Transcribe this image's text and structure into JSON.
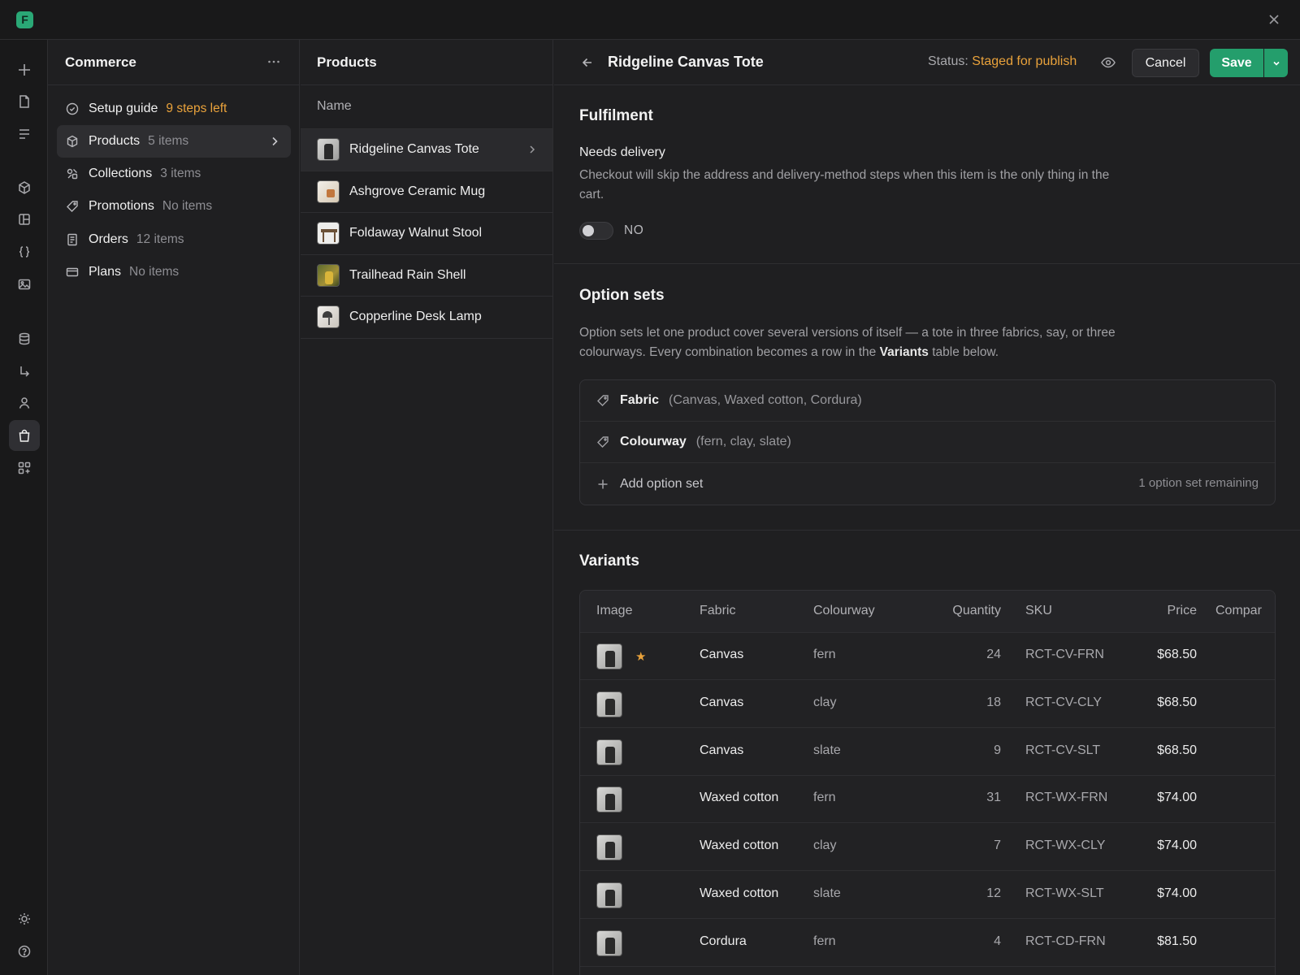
{
  "app": {
    "logo_letter": "F"
  },
  "rail": {
    "icons": [
      "plus-icon",
      "document-icon",
      "text-lines-icon",
      "cube-icon",
      "layout-icon",
      "code-braces-icon",
      "image-icon",
      "database-icon",
      "arrow-turn-icon",
      "user-icon",
      "shopping-bag-icon",
      "apps-add-icon",
      "sun-icon",
      "help-icon"
    ],
    "active": "shopping-bag-icon"
  },
  "sidebar": {
    "title": "Commerce",
    "items": [
      {
        "label": "Setup guide",
        "count": "9 steps left",
        "icon": "check-circle-icon",
        "warn": true
      },
      {
        "label": "Products",
        "count": "5 items",
        "icon": "cube-icon",
        "active": true
      },
      {
        "label": "Collections",
        "count": "3 items",
        "icon": "collections-icon"
      },
      {
        "label": "Promotions",
        "count": "No items",
        "icon": "tag-icon"
      },
      {
        "label": "Orders",
        "count": "12 items",
        "icon": "receipt-icon"
      },
      {
        "label": "Plans",
        "count": "No items",
        "icon": "card-icon"
      }
    ]
  },
  "products": {
    "title": "Products",
    "column": "Name",
    "items": [
      {
        "label": "Ridgeline Canvas Tote",
        "active": true
      },
      {
        "label": "Ashgrove Ceramic Mug"
      },
      {
        "label": "Foldaway Walnut Stool"
      },
      {
        "label": "Trailhead Rain Shell"
      },
      {
        "label": "Copperline Desk Lamp"
      }
    ]
  },
  "detail": {
    "title": "Ridgeline Canvas Tote",
    "status_label": "Status:",
    "status_value": "Staged for publish",
    "cancel_label": "Cancel",
    "save_label": "Save",
    "accent": "#249e6c",
    "warn_color": "#e9a23b"
  },
  "fulfilment": {
    "title": "Fulfilment",
    "field_label": "Needs delivery",
    "description": "Checkout will skip the address and delivery-method steps when this item is the only thing in the cart.",
    "toggle_value": "NO"
  },
  "option_sets": {
    "title": "Option sets",
    "description_part1": "Option sets let one product cover several versions of itself — a tote in three fabrics, say, or three colourways. Every combination becomes a row in the ",
    "description_bold": "Variants",
    "description_part2": " table below.",
    "sets": [
      {
        "name": "Fabric",
        "values": "(Canvas, Waxed cotton, Cordura)"
      },
      {
        "name": "Colourway",
        "values": "(fern, clay, slate)"
      }
    ],
    "add_label": "Add option set",
    "remaining": "1 option set remaining"
  },
  "variants": {
    "title": "Variants",
    "columns": [
      "Image",
      "Fabric",
      "Colourway",
      "Quantity",
      "SKU",
      "Price",
      "Compar"
    ],
    "rows": [
      {
        "fabric": "Canvas",
        "colourway": "fern",
        "quantity": "24",
        "sku": "RCT-CV-FRN",
        "price": "$68.50",
        "starred": true
      },
      {
        "fabric": "Canvas",
        "colourway": "clay",
        "quantity": "18",
        "sku": "RCT-CV-CLY",
        "price": "$68.50"
      },
      {
        "fabric": "Canvas",
        "colourway": "slate",
        "quantity": "9",
        "sku": "RCT-CV-SLT",
        "price": "$68.50"
      },
      {
        "fabric": "Waxed cotton",
        "colourway": "fern",
        "quantity": "31",
        "sku": "RCT-WX-FRN",
        "price": "$74.00"
      },
      {
        "fabric": "Waxed cotton",
        "colourway": "clay",
        "quantity": "7",
        "sku": "RCT-WX-CLY",
        "price": "$74.00"
      },
      {
        "fabric": "Waxed cotton",
        "colourway": "slate",
        "quantity": "12",
        "sku": "RCT-WX-SLT",
        "price": "$74.00"
      },
      {
        "fabric": "Cordura",
        "colourway": "fern",
        "quantity": "4",
        "sku": "RCT-CD-FRN",
        "price": "$81.50"
      }
    ]
  }
}
